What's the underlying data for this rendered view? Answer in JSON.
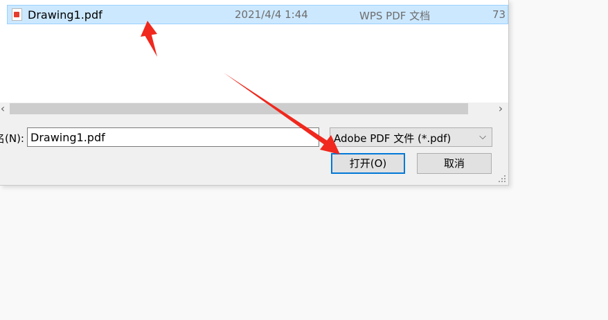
{
  "file_list": {
    "rows": [
      {
        "name": "Drawing1.pdf",
        "modified": "2021/4/4 1:44",
        "type": "WPS PDF 文档",
        "size": "73",
        "icon": "pdf-file-icon",
        "selected": true
      }
    ]
  },
  "scrollbar": {
    "left_arrow": "‹",
    "right_arrow": "›"
  },
  "file_name": {
    "label": "名(N):",
    "value": "Drawing1.pdf"
  },
  "file_type": {
    "selected": "Adobe PDF 文件 (*.pdf)",
    "chevron": "⌵"
  },
  "buttons": {
    "open": "打开(O)",
    "cancel": "取消"
  },
  "colors": {
    "selection_bg": "#cce8ff",
    "selection_border": "#99d1ff",
    "focus_border": "#0078d7",
    "annotation_arrow": "#f0281e"
  }
}
